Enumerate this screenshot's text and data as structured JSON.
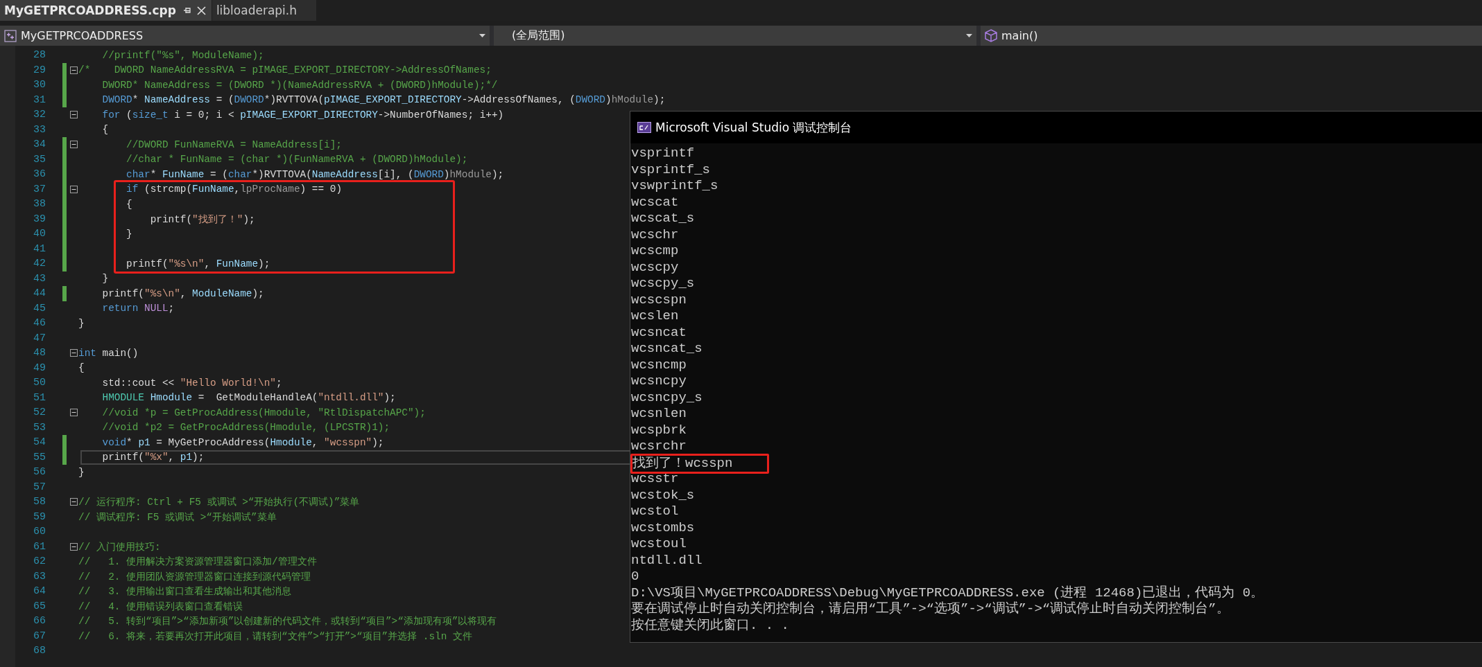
{
  "tabs": [
    {
      "label": "MyGETPRCOADDRESS.cpp",
      "selected": true
    },
    {
      "label": "libloaderapi.h",
      "selected": false
    }
  ],
  "navigation": {
    "project": "MyGETPRCOADDRESS",
    "scope": "(全局范围)",
    "member": "main()"
  },
  "editor": {
    "lines": [
      {
        "number": "28",
        "changed": false,
        "fold": false,
        "boxed": false,
        "current": false,
        "tokens": [
          {
            "kind": "comment",
            "text": "    //printf(\"%s\", ModuleName);"
          }
        ]
      },
      {
        "number": "29",
        "changed": true,
        "fold": true,
        "boxed": false,
        "current": false,
        "tokens": [
          {
            "kind": "comment",
            "text": "/*    DWORD NameAddressRVA = pIMAGE_EXPORT_DIRECTORY->AddressOfNames;"
          }
        ]
      },
      {
        "number": "30",
        "changed": true,
        "fold": false,
        "boxed": false,
        "current": false,
        "tokens": [
          {
            "kind": "comment",
            "text": "    DWORD* NameAddress = (DWORD *)(NameAddressRVA + (DWORD)hModule);*/"
          }
        ]
      },
      {
        "number": "31",
        "changed": true,
        "fold": false,
        "boxed": false,
        "current": false,
        "tokens": [
          {
            "kind": "keyword",
            "text": "    DWORD"
          },
          {
            "kind": "plain",
            "text": "* "
          },
          {
            "kind": "variable",
            "text": "NameAddress"
          },
          {
            "kind": "plain",
            "text": " = ("
          },
          {
            "kind": "keyword",
            "text": "DWORD"
          },
          {
            "kind": "plain",
            "text": "*)RVTTOVA("
          },
          {
            "kind": "variable",
            "text": "pIMAGE_EXPORT_DIRECTORY"
          },
          {
            "kind": "plain",
            "text": "->AddressOfNames, ("
          },
          {
            "kind": "keyword",
            "text": "DWORD"
          },
          {
            "kind": "plain",
            "text": ")"
          },
          {
            "kind": "param",
            "text": "hModule"
          },
          {
            "kind": "plain",
            "text": ");"
          }
        ]
      },
      {
        "number": "32",
        "changed": false,
        "fold": true,
        "boxed": false,
        "current": false,
        "tokens": [
          {
            "kind": "keyword",
            "text": "    for"
          },
          {
            "kind": "plain",
            "text": " ("
          },
          {
            "kind": "keyword",
            "text": "size_t"
          },
          {
            "kind": "plain",
            "text": " i = 0; i < "
          },
          {
            "kind": "variable",
            "text": "pIMAGE_EXPORT_DIRECTORY"
          },
          {
            "kind": "plain",
            "text": "->NumberOfNames; i++)"
          }
        ]
      },
      {
        "number": "33",
        "changed": false,
        "fold": false,
        "boxed": false,
        "current": false,
        "tokens": [
          {
            "kind": "plain",
            "text": "    {"
          }
        ]
      },
      {
        "number": "34",
        "changed": true,
        "fold": true,
        "boxed": false,
        "current": false,
        "tokens": [
          {
            "kind": "comment",
            "text": "        //DWORD FunNameRVA = NameAddress[i];"
          }
        ]
      },
      {
        "number": "35",
        "changed": true,
        "fold": false,
        "boxed": false,
        "current": false,
        "tokens": [
          {
            "kind": "comment",
            "text": "        //char * FunName = (char *)(FunNameRVA + (DWORD)hModule);"
          }
        ]
      },
      {
        "number": "36",
        "changed": true,
        "fold": false,
        "boxed": false,
        "current": false,
        "tokens": [
          {
            "kind": "keyword",
            "text": "        char"
          },
          {
            "kind": "plain",
            "text": "* "
          },
          {
            "kind": "variable",
            "text": "FunName"
          },
          {
            "kind": "plain",
            "text": " = ("
          },
          {
            "kind": "keyword",
            "text": "char"
          },
          {
            "kind": "plain",
            "text": "*)RVTTOVA("
          },
          {
            "kind": "variable",
            "text": "NameAddress"
          },
          {
            "kind": "plain",
            "text": "[i], ("
          },
          {
            "kind": "keyword",
            "text": "DWORD"
          },
          {
            "kind": "plain",
            "text": ")"
          },
          {
            "kind": "param",
            "text": "hModule"
          },
          {
            "kind": "plain",
            "text": ");"
          }
        ]
      },
      {
        "number": "37",
        "changed": true,
        "fold": true,
        "boxed": true,
        "current": false,
        "tokens": [
          {
            "kind": "keyword",
            "text": "        if"
          },
          {
            "kind": "plain",
            "text": " (strcmp("
          },
          {
            "kind": "variable",
            "text": "FunName"
          },
          {
            "kind": "plain",
            "text": ","
          },
          {
            "kind": "param",
            "text": "lpProcName"
          },
          {
            "kind": "plain",
            "text": ") == 0)"
          }
        ]
      },
      {
        "number": "38",
        "changed": true,
        "fold": false,
        "boxed": true,
        "current": false,
        "tokens": [
          {
            "kind": "plain",
            "text": "        {"
          }
        ]
      },
      {
        "number": "39",
        "changed": true,
        "fold": false,
        "boxed": true,
        "current": false,
        "tokens": [
          {
            "kind": "plain",
            "text": "            printf("
          },
          {
            "kind": "string",
            "text": "\"找到了！\""
          },
          {
            "kind": "plain",
            "text": ");"
          }
        ]
      },
      {
        "number": "40",
        "changed": true,
        "fold": false,
        "boxed": true,
        "current": false,
        "tokens": [
          {
            "kind": "plain",
            "text": "        }"
          }
        ]
      },
      {
        "number": "41",
        "changed": true,
        "fold": false,
        "boxed": true,
        "current": false
      },
      {
        "number": "42",
        "changed": true,
        "fold": false,
        "boxed": true,
        "current": false,
        "tokens": [
          {
            "kind": "plain",
            "text": "        printf("
          },
          {
            "kind": "string",
            "text": "\"%s\\n\""
          },
          {
            "kind": "plain",
            "text": ", "
          },
          {
            "kind": "variable",
            "text": "FunName"
          },
          {
            "kind": "plain",
            "text": ");"
          }
        ]
      },
      {
        "number": "43",
        "changed": false,
        "fold": false,
        "boxed": false,
        "current": false,
        "tokens": [
          {
            "kind": "plain",
            "text": "    }"
          }
        ]
      },
      {
        "number": "44",
        "changed": true,
        "fold": false,
        "boxed": false,
        "current": false,
        "tokens": [
          {
            "kind": "plain",
            "text": "    printf("
          },
          {
            "kind": "string",
            "text": "\"%s\\n\""
          },
          {
            "kind": "plain",
            "text": ", "
          },
          {
            "kind": "variable",
            "text": "ModuleName"
          },
          {
            "kind": "plain",
            "text": ");"
          }
        ]
      },
      {
        "number": "45",
        "changed": false,
        "fold": false,
        "boxed": false,
        "current": false,
        "tokens": [
          {
            "kind": "keyword",
            "text": "    return"
          },
          {
            "kind": "macro",
            "text": " NULL"
          },
          {
            "kind": "plain",
            "text": ";"
          }
        ]
      },
      {
        "number": "46",
        "changed": false,
        "fold": false,
        "boxed": false,
        "current": false,
        "tokens": [
          {
            "kind": "plain",
            "text": "}"
          }
        ]
      },
      {
        "number": "47",
        "changed": false,
        "fold": false,
        "boxed": false,
        "current": false
      },
      {
        "number": "48",
        "changed": false,
        "fold": true,
        "boxed": false,
        "current": false,
        "tokens": [
          {
            "kind": "keyword",
            "text": "int"
          },
          {
            "kind": "plain",
            "text": " main()"
          }
        ]
      },
      {
        "number": "49",
        "changed": false,
        "fold": false,
        "boxed": false,
        "current": false,
        "tokens": [
          {
            "kind": "plain",
            "text": "{"
          }
        ]
      },
      {
        "number": "50",
        "changed": false,
        "fold": false,
        "boxed": false,
        "current": false,
        "tokens": [
          {
            "kind": "plain",
            "text": "    std::cout << "
          },
          {
            "kind": "string",
            "text": "\"Hello World!\\n\""
          },
          {
            "kind": "plain",
            "text": ";"
          }
        ]
      },
      {
        "number": "51",
        "changed": false,
        "fold": false,
        "boxed": false,
        "current": false,
        "tokens": [
          {
            "kind": "type",
            "text": "    HMODULE"
          },
          {
            "kind": "variable",
            "text": " Hmodule"
          },
          {
            "kind": "plain",
            "text": " =  GetModuleHandleA("
          },
          {
            "kind": "string",
            "text": "\"ntdll.dll\""
          },
          {
            "kind": "plain",
            "text": ");"
          }
        ]
      },
      {
        "number": "52",
        "changed": false,
        "fold": true,
        "boxed": false,
        "current": false,
        "tokens": [
          {
            "kind": "comment",
            "text": "    //void *p = GetProcAddress(Hmodule, \"RtlDispatchAPC\");"
          }
        ]
      },
      {
        "number": "53",
        "changed": false,
        "fold": false,
        "boxed": false,
        "current": false,
        "tokens": [
          {
            "kind": "comment",
            "text": "    //void *p2 = GetProcAddress(Hmodule, (LPCSTR)1);"
          }
        ]
      },
      {
        "number": "54",
        "changed": true,
        "fold": false,
        "boxed": false,
        "current": false,
        "tokens": [
          {
            "kind": "keyword",
            "text": "    void"
          },
          {
            "kind": "plain",
            "text": "* "
          },
          {
            "kind": "variable",
            "text": "p1"
          },
          {
            "kind": "plain",
            "text": " = MyGetProcAddress("
          },
          {
            "kind": "variable",
            "text": "Hmodule"
          },
          {
            "kind": "plain",
            "text": ", "
          },
          {
            "kind": "string",
            "text": "\"wcsspn\""
          },
          {
            "kind": "plain",
            "text": ");"
          }
        ]
      },
      {
        "number": "55",
        "changed": true,
        "fold": false,
        "boxed": false,
        "current": true,
        "tokens": [
          {
            "kind": "plain",
            "text": "    printf("
          },
          {
            "kind": "string",
            "text": "\"%x\""
          },
          {
            "kind": "plain",
            "text": ", "
          },
          {
            "kind": "variable",
            "text": "p1"
          },
          {
            "kind": "plain",
            "text": ");"
          }
        ]
      },
      {
        "number": "56",
        "changed": false,
        "fold": false,
        "boxed": false,
        "current": false,
        "tokens": [
          {
            "kind": "plain",
            "text": "}"
          }
        ]
      },
      {
        "number": "57",
        "changed": false,
        "fold": false,
        "boxed": false,
        "current": false
      },
      {
        "number": "58",
        "changed": false,
        "fold": true,
        "boxed": false,
        "current": false,
        "tokens": [
          {
            "kind": "comment",
            "text": "// 运行程序: Ctrl + F5 或调试 >“开始执行(不调试)”菜单"
          }
        ]
      },
      {
        "number": "59",
        "changed": false,
        "fold": false,
        "boxed": false,
        "current": false,
        "tokens": [
          {
            "kind": "comment",
            "text": "// 调试程序: F5 或调试 >“开始调试”菜单"
          }
        ]
      },
      {
        "number": "60",
        "changed": false,
        "fold": false,
        "boxed": false,
        "current": false
      },
      {
        "number": "61",
        "changed": false,
        "fold": true,
        "boxed": false,
        "current": false,
        "tokens": [
          {
            "kind": "comment",
            "text": "// 入门使用技巧:"
          }
        ]
      },
      {
        "number": "62",
        "changed": false,
        "fold": false,
        "boxed": false,
        "current": false,
        "tokens": [
          {
            "kind": "comment",
            "text": "//   1. 使用解决方案资源管理器窗口添加/管理文件"
          }
        ]
      },
      {
        "number": "63",
        "changed": false,
        "fold": false,
        "boxed": false,
        "current": false,
        "tokens": [
          {
            "kind": "comment",
            "text": "//   2. 使用团队资源管理器窗口连接到源代码管理"
          }
        ]
      },
      {
        "number": "64",
        "changed": false,
        "fold": false,
        "boxed": false,
        "current": false,
        "tokens": [
          {
            "kind": "comment",
            "text": "//   3. 使用输出窗口查看生成输出和其他消息"
          }
        ]
      },
      {
        "number": "65",
        "changed": false,
        "fold": false,
        "boxed": false,
        "current": false,
        "tokens": [
          {
            "kind": "comment",
            "text": "//   4. 使用错误列表窗口查看错误"
          }
        ]
      },
      {
        "number": "66",
        "changed": false,
        "fold": false,
        "boxed": false,
        "current": false,
        "tokens": [
          {
            "kind": "comment",
            "text": "//   5. 转到“项目”>“添加新项”以创建新的代码文件，或转到“项目”>“添加现有项”以将现有"
          }
        ]
      },
      {
        "number": "67",
        "changed": false,
        "fold": false,
        "boxed": false,
        "current": false,
        "tokens": [
          {
            "kind": "comment",
            "text": "//   6. 将来，若要再次打开此项目，请转到“文件”>“打开”>“项目”并选择 .sln 文件"
          }
        ]
      },
      {
        "number": "68",
        "changed": false,
        "fold": false,
        "boxed": false,
        "current": false
      }
    ]
  },
  "console": {
    "title": "Microsoft Visual Studio 调试控制台",
    "lines": [
      {
        "text": "vsprintf",
        "boxed": false
      },
      {
        "text": "vsprintf_s",
        "boxed": false
      },
      {
        "text": "vswprintf_s",
        "boxed": false
      },
      {
        "text": "wcscat",
        "boxed": false
      },
      {
        "text": "wcscat_s",
        "boxed": false
      },
      {
        "text": "wcschr",
        "boxed": false
      },
      {
        "text": "wcscmp",
        "boxed": false
      },
      {
        "text": "wcscpy",
        "boxed": false
      },
      {
        "text": "wcscpy_s",
        "boxed": false
      },
      {
        "text": "wcscspn",
        "boxed": false
      },
      {
        "text": "wcslen",
        "boxed": false
      },
      {
        "text": "wcsncat",
        "boxed": false
      },
      {
        "text": "wcsncat_s",
        "boxed": false
      },
      {
        "text": "wcsncmp",
        "boxed": false
      },
      {
        "text": "wcsncpy",
        "boxed": false
      },
      {
        "text": "wcsncpy_s",
        "boxed": false
      },
      {
        "text": "wcsnlen",
        "boxed": false
      },
      {
        "text": "wcspbrk",
        "boxed": false
      },
      {
        "text": "wcsrchr",
        "boxed": false
      },
      {
        "text": "找到了！wcsspn",
        "boxed": true
      },
      {
        "text": "wcsstr",
        "boxed": false
      },
      {
        "text": "wcstok_s",
        "boxed": false
      },
      {
        "text": "wcstol",
        "boxed": false
      },
      {
        "text": "wcstombs",
        "boxed": false
      },
      {
        "text": "wcstoul",
        "boxed": false
      },
      {
        "text": "ntdll.dll",
        "boxed": false
      },
      {
        "text": "0",
        "boxed": false
      },
      {
        "text": "D:\\VS项目\\MyGETPRCOADDRESS\\Debug\\MyGETPRCOADDRESS.exe (进程 12468)已退出，代码为 0。",
        "boxed": false
      },
      {
        "text": "要在调试停止时自动关闭控制台，请启用“工具”->“选项”->“调试”->“调试停止时自动关闭控制台”。",
        "boxed": false
      },
      {
        "text": "按任意键关闭此窗口. . .",
        "boxed": false
      }
    ]
  }
}
